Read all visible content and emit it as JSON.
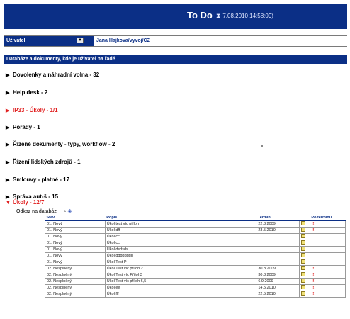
{
  "header": {
    "title": "To Do",
    "timestamp": "7.08.2010 14:58:09)"
  },
  "user": {
    "label": "Uživatel",
    "name": "Jana Hajkova/vyvoj/CZ"
  },
  "databases": {
    "heading": "Databáze a dokumenty, kde je uživatel na řadě",
    "items": [
      {
        "label": "Dovolenky a náhradní volna - 32",
        "color": "#000000"
      },
      {
        "label": "Help desk - 2",
        "color": "#000000"
      },
      {
        "label": "IP33 - Úkoly - 1/1",
        "color": "#e02020"
      },
      {
        "label": "Porady - 1",
        "color": "#000000"
      },
      {
        "label": "Řízené dokumenty - typy, workflow - 2",
        "color": "#000000"
      },
      {
        "label": "Řízení lidských zdrojů - 1",
        "color": "#000000"
      },
      {
        "label": "Smlouvy - platné - 17",
        "color": "#000000"
      },
      {
        "label": "Správa aut-š - 15",
        "color": "#000000"
      },
      {
        "label": "Úkoly - 12/7",
        "color": "#e02020"
      }
    ]
  },
  "db_link": {
    "label": "Odkaz na databázi"
  },
  "table": {
    "headers": {
      "stav": "Stav",
      "popis": "Popis",
      "termin": "Termín",
      "po_terminu": "Po termínu"
    },
    "rows": [
      {
        "stav": "01. Nový",
        "popis": "Úkol test víc příloh",
        "termin": "22.8.2009",
        "flag": "!!!"
      },
      {
        "stav": "01. Nový",
        "popis": "Úkol dff",
        "termin": "23.5.2010",
        "flag": "!!!"
      },
      {
        "stav": "01. Nový",
        "popis": "Úkol cc",
        "termin": "",
        "flag": ""
      },
      {
        "stav": "01. Nový",
        "popis": "Úkol cc",
        "termin": "",
        "flag": ""
      },
      {
        "stav": "01. Nový",
        "popis": "Úkol dsdsds",
        "termin": "",
        "flag": ""
      },
      {
        "stav": "01. Nový",
        "popis": "Úkol qqqqqqqq",
        "termin": "",
        "flag": ""
      },
      {
        "stav": "01. Nový",
        "popis": "Úkol Test P",
        "termin": "",
        "flag": ""
      },
      {
        "stav": "02. Nesplněný",
        "popis": "Úkol Test víc příloh 2",
        "termin": "30.8.2009",
        "flag": "!!!"
      },
      {
        "stav": "02. Nesplněný",
        "popis": "Úkol Test víc Příloh3",
        "termin": "30.8.2009",
        "flag": "!!!"
      },
      {
        "stav": "02. Nesplněný",
        "popis": "Úkol Test víc příloh 6,5",
        "termin": "6.9.2009",
        "flag": "!!!"
      },
      {
        "stav": "02. Nesplněný",
        "popis": "Úkol ee",
        "termin": "14.5.2010",
        "flag": "!!!"
      },
      {
        "stav": "02. Nesplněný",
        "popis": "Úkol fff",
        "termin": "22.5.2010",
        "flag": "!!!"
      }
    ]
  },
  "icons": {
    "header": "clock-icon",
    "doc": "document-icon",
    "db": "database-icon"
  },
  "colors": {
    "brand": "#0b2f86",
    "alert": "#e02020"
  }
}
